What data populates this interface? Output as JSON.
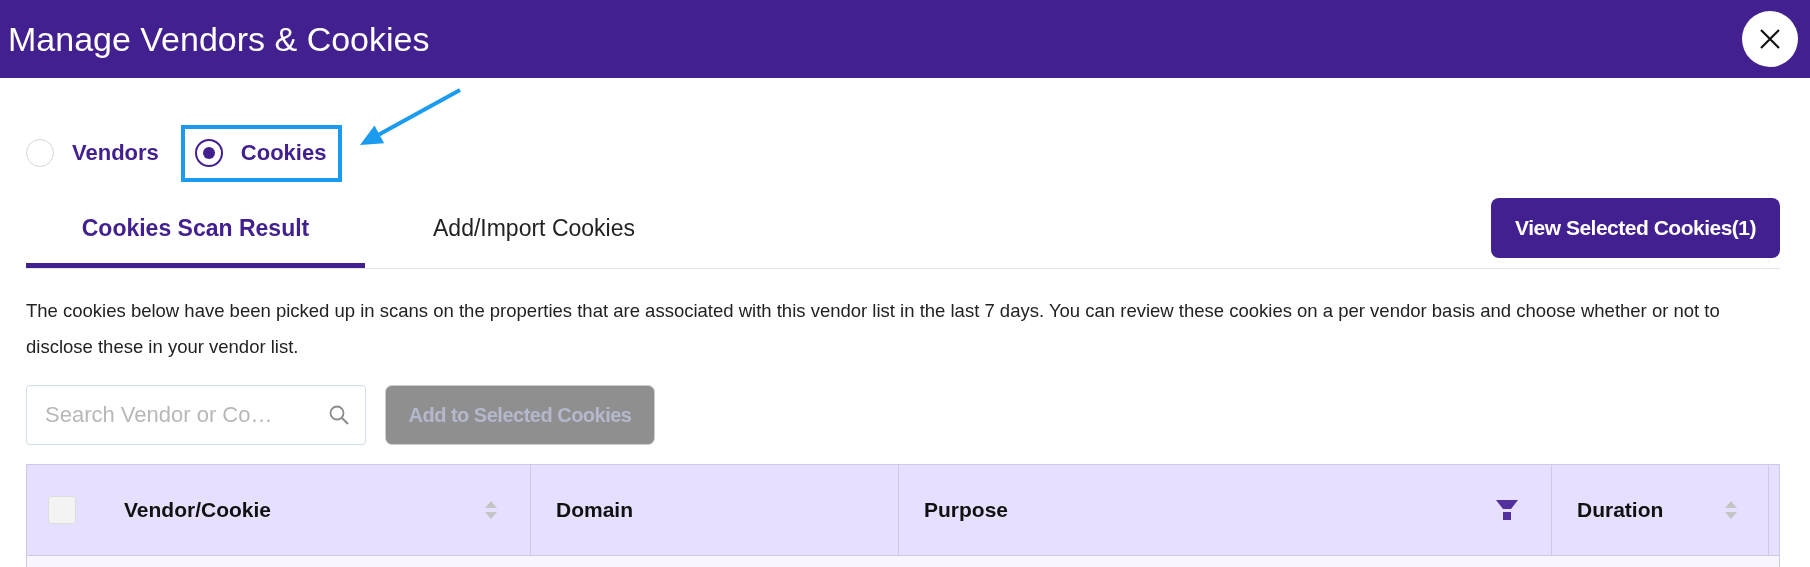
{
  "window": {
    "title": "Manage Vendors & Cookies"
  },
  "mode_options": [
    {
      "label": "Vendors",
      "selected": false,
      "annotated": false
    },
    {
      "label": "Cookies",
      "selected": true,
      "annotated": true
    }
  ],
  "tabs": [
    {
      "label": "Cookies Scan Result",
      "selected": true
    },
    {
      "label": "Add/Import Cookies",
      "selected": false
    }
  ],
  "view_selected_button": "View Selected Cookies(1)",
  "description": "The cookies below have been picked up in scans on the properties that are associated with this vendor list in the last 7 days. You can review these cookies on a per vendor basis and choose whether or not to disclose these in your vendor list.",
  "search": {
    "placeholder": "Search Vendor or Co…"
  },
  "add_button": {
    "label": "Add to Selected Cookies",
    "disabled": true
  },
  "table": {
    "select_all_checked": false,
    "columns": [
      {
        "label": "Vendor/Cookie",
        "kind": "sort"
      },
      {
        "label": "Domain",
        "kind": "plain"
      },
      {
        "label": "Purpose",
        "kind": "filter"
      },
      {
        "label": "Duration",
        "kind": "sort"
      }
    ]
  }
}
